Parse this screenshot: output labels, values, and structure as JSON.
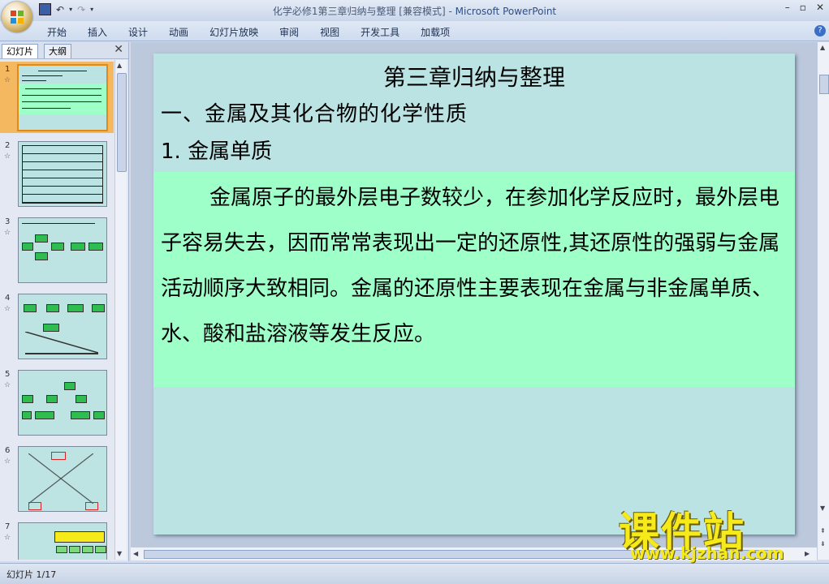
{
  "window": {
    "doc_title": "化学必修1第三章归纳与整理 [兼容模式] - ",
    "app_name": "Microsoft PowerPoint",
    "controls": [
      "–",
      "▫",
      "✕"
    ]
  },
  "quick_access": [
    "save-icon",
    "undo-icon",
    "redo-icon",
    "customize-icon"
  ],
  "ribbon": {
    "tabs": [
      "开始",
      "插入",
      "设计",
      "动画",
      "幻灯片放映",
      "审阅",
      "视图",
      "开发工具",
      "加载项"
    ],
    "help": "?"
  },
  "panel": {
    "tab_slides": "幻灯片",
    "tab_outline": "大纲",
    "close": "✕",
    "slides": [
      {
        "num": "1",
        "selected": true
      },
      {
        "num": "2",
        "selected": false
      },
      {
        "num": "3",
        "selected": false
      },
      {
        "num": "4",
        "selected": false
      },
      {
        "num": "5",
        "selected": false
      },
      {
        "num": "6",
        "selected": false
      },
      {
        "num": "7",
        "selected": false
      }
    ]
  },
  "slide": {
    "title": "第三章归纳与整理",
    "heading1": "一、金属及其化合物的化学性质",
    "heading2": "1. 金属单质",
    "body": "金属原子的最外层电子数较少，在参加化学反应时，最外层电子容易失去，因而常常表现出一定的还原性,其还原性的强弱与金属活动顺序大致相同。金属的还原性主要表现在金属与非金属单质、水、酸和盐溶液等发生反应。"
  },
  "status": {
    "slide_counter": "幻灯片 1/17"
  },
  "watermark": {
    "name": "课件站",
    "url": "www.kjzhan.com"
  },
  "colors": {
    "slide_bg": "#bce3e3",
    "body_highlight": "#9fffc9",
    "selection": "#f4b860",
    "watermark": "#f6ea1a"
  }
}
